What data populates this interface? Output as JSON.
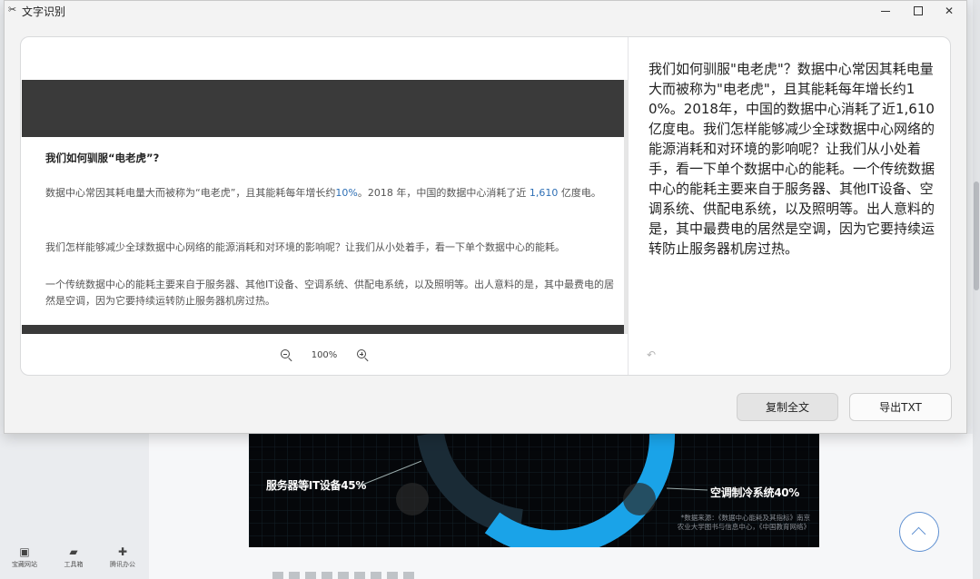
{
  "window": {
    "title": "文字识别"
  },
  "image_preview": {
    "heading": "我们如何驯服“电老虎”?",
    "p1_a": "数据中心常因其耗电量大而被称为“电老虎”，且其能耗每年增长约",
    "p1_b": "10%",
    "p1_c": "。2018 年，中国的数据中心消耗了近",
    "p1_d": "1,610",
    "p1_e": "亿度电。",
    "p2": "我们怎样能够减少全球数据中心网络的能源消耗和对环境的影响呢？让我们从小处着手，看一下单个数据中心的能耗。",
    "p3": "一个传统数据中心的能耗主要来自于服务器、其他IT设备、空调系统、供配电系统，以及照明等。出人意料的是，其中最费电的居然是空调，因为它要持续运转防止服务器机房过热。",
    "zoom_level": "100%"
  },
  "result": {
    "text": "我们如何驯服\"电老虎\"？数据中心常因其耗电量大而被称为\"电老虎\"，且其能耗每年增长约10%。2018年，中国的数据中心消耗了近1,610亿度电。我们怎样能够减少全球数据中心网络的能源消耗和对环境的影响呢？让我们从小处着手，看一下单个数据中心的能耗。一个传统数据中心的能耗主要来自于服务器、其他IT设备、空调系统、供配电系统，以及照明等。出人意料的是，其中最费电的居然是空调，因为它要持续运转防止服务器机房过热。"
  },
  "buttons": {
    "copy_all": "复制全文",
    "export_txt": "导出TXT"
  },
  "background": {
    "label_left": "服务器等IT设备45%",
    "label_right": "空调制冷系统40%",
    "source_line1": "*数据来源：《数据中心能耗及其指标》南京",
    "source_line2": "农业大学图书与信息中心，《中国教育网络》",
    "nav": [
      "宝藏网站",
      "工具箱",
      "腾讯办公"
    ]
  },
  "colors": {
    "accent_blue": "#1aa3e8",
    "link_blue": "#2e6fb5",
    "arrow_blue": "#5d8fd1"
  }
}
